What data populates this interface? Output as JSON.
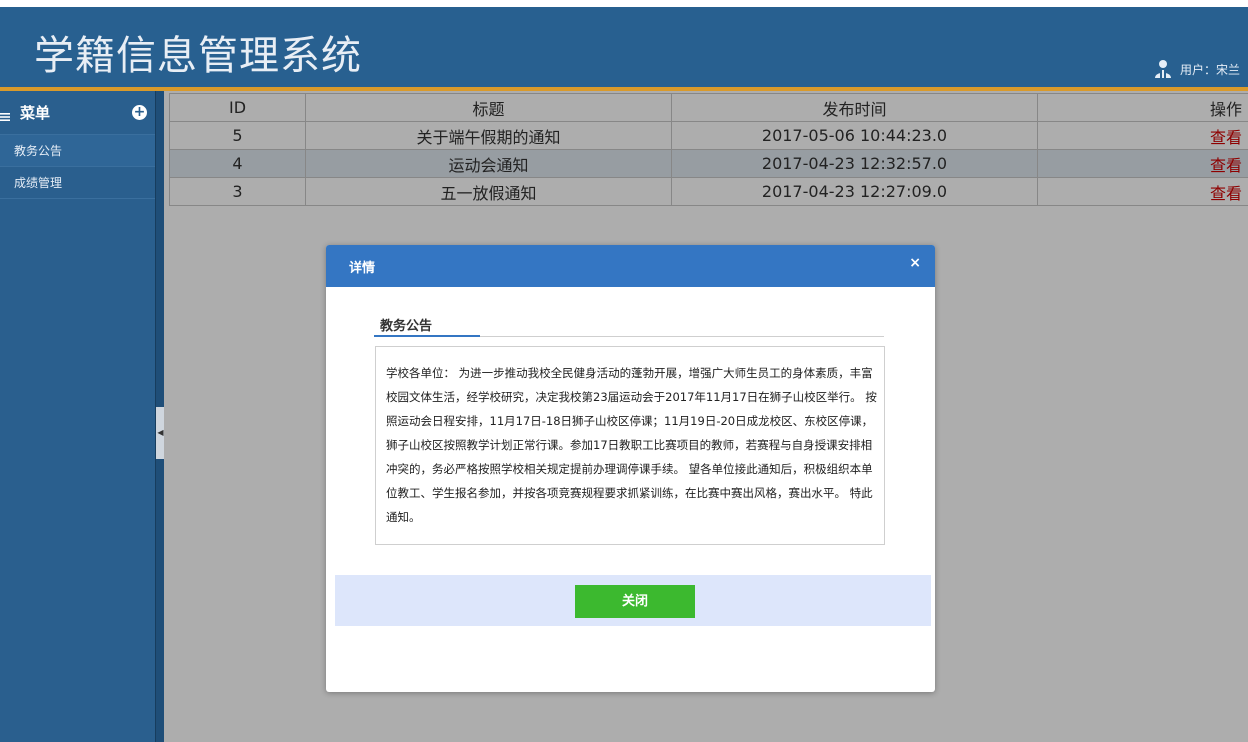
{
  "app": {
    "title": "学籍信息管理系统",
    "user_label": "用户：宋兰"
  },
  "sidebar": {
    "header_label": "菜单",
    "items": [
      {
        "label": "教务公告"
      },
      {
        "label": "成绩管理"
      }
    ]
  },
  "table": {
    "headers": [
      "ID",
      "标题",
      "发布时间",
      "操作"
    ],
    "rows": [
      {
        "id": "5",
        "title": "关于端午假期的通知",
        "time": "2017-05-06 10:44:23.0",
        "action": "查看"
      },
      {
        "id": "4",
        "title": "运动会通知",
        "time": "2017-04-23 12:32:57.0",
        "action": "查看"
      },
      {
        "id": "3",
        "title": "五一放假通知",
        "time": "2017-04-23 12:27:09.0",
        "action": "查看"
      }
    ]
  },
  "dialog": {
    "title": "详情",
    "close_symbol": "×",
    "section_label": "教务公告",
    "body": "学校各单位： 为进一步推动我校全民健身活动的蓬勃开展，增强广大师生员工的身体素质，丰富校园文体生活，经学校研究，决定我校第23届运动会于2017年11月17日在狮子山校区举行。 按照运动会日程安排，11月17日-18日狮子山校区停课；11月19日-20日成龙校区、东校区停课，狮子山校区按照教学计划正常行课。参加17日教职工比赛项目的教师，若赛程与自身授课安排相冲突的，务必严格按照学校相关规定提前办理调停课手续。 望各单位接此通知后，积极组织本单位教工、学生报名参加，并按各项竞赛规程要求抓紧训练，在比赛中赛出风格，赛出水平。 特此通知。",
    "close_button_label": "关闭"
  },
  "colors": {
    "header_bg": "#286090",
    "header_accent": "#d99a2b",
    "dialog_header": "#3476c3",
    "close_button": "#3cb92f",
    "link_red": "#d10000"
  }
}
